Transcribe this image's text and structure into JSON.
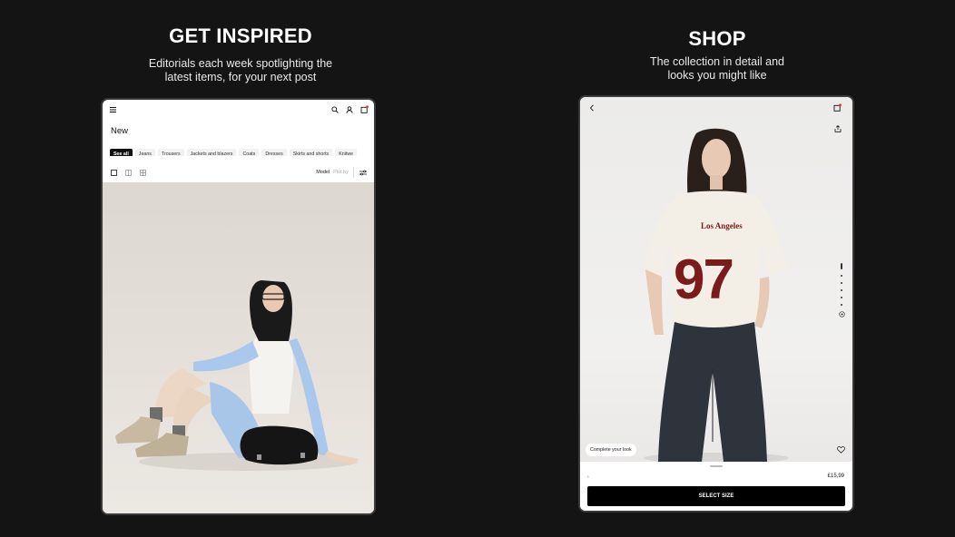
{
  "left_panel": {
    "headline": "GET INSPIRED",
    "subtitle_lines": [
      "Editorials each week spotlighting the",
      "latest items, for your next post"
    ],
    "screen": {
      "topbar": {
        "menu_icon": "hamburger-menu-icon",
        "search_icon": "search-icon",
        "account_icon": "user-icon",
        "bag_icon": "shopping-bag-icon"
      },
      "title": "New",
      "chips": [
        {
          "label": "See all",
          "active": true
        },
        {
          "label": "Jeans",
          "active": false
        },
        {
          "label": "Trousers",
          "active": false
        },
        {
          "label": "Jackets and blazers",
          "active": false
        },
        {
          "label": "Coats",
          "active": false
        },
        {
          "label": "Dresses",
          "active": false
        },
        {
          "label": "Skirts and shorts",
          "active": false
        },
        {
          "label": "Knitwe",
          "active": false
        }
      ],
      "view_toggle": [
        "single-column-icon",
        "two-column-icon",
        "grid-icon"
      ],
      "model_label": "Model",
      "model_value": "Plot by",
      "filter_icon": "filter-sliders-icon",
      "image": "editorial-photo-woman-sitting-with-bag"
    }
  },
  "right_panel": {
    "headline": "SHOP",
    "subtitle_lines": [
      "The collection in detail and",
      "looks you might like"
    ],
    "screen": {
      "back_icon": "chevron-left-icon",
      "bag_icon": "shopping-bag-icon",
      "share_icon": "share-icon",
      "image": "product-photo-oversized-jersey-97-baggy-jeans",
      "shirt_text": "Los Angeles",
      "shirt_number": "97",
      "complete_look_label": "Complete your look",
      "wishlist_icon": "heart-icon",
      "gallery_dots": 6,
      "zoom_icon": "zoom-icon",
      "price": "£15,99",
      "select_size_label": "SELECT SIZE"
    }
  }
}
